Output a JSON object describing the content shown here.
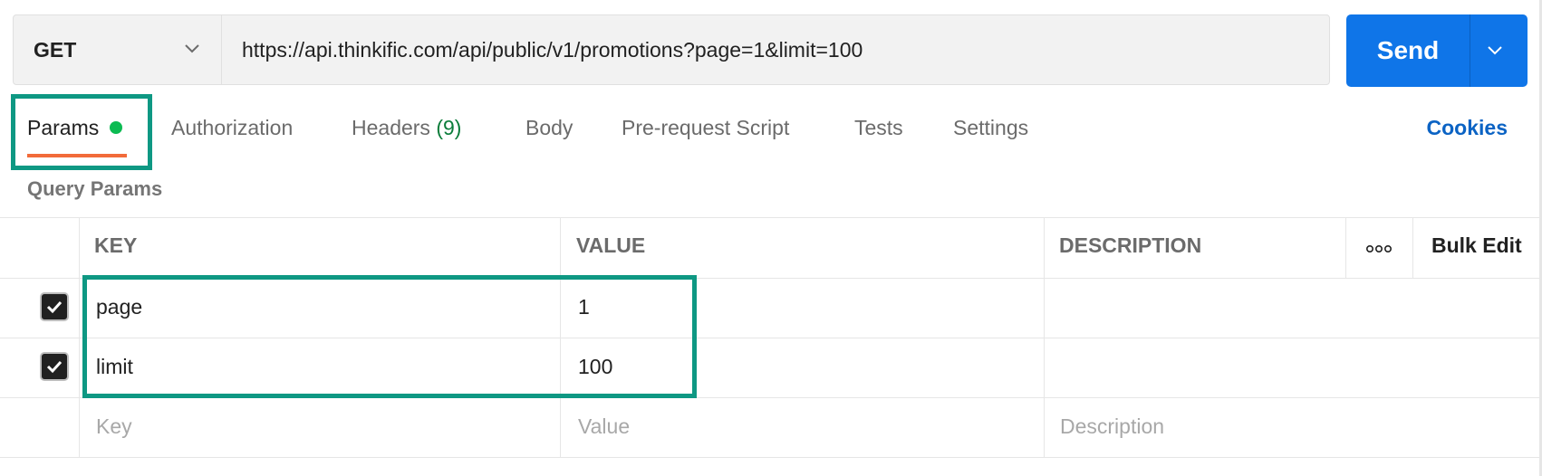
{
  "request": {
    "method": "GET",
    "url": "https://api.thinkific.com/api/public/v1/promotions?page=1&limit=100",
    "send_label": "Send"
  },
  "tabs": [
    {
      "label": "Params"
    },
    {
      "label": "Authorization"
    },
    {
      "label": "Headers",
      "count": "(9)"
    },
    {
      "label": "Body"
    },
    {
      "label": "Pre-request Script"
    },
    {
      "label": "Tests"
    },
    {
      "label": "Settings"
    }
  ],
  "cookies_label": "Cookies",
  "query_params": {
    "title": "Query Params",
    "columns": [
      "KEY",
      "VALUE",
      "DESCRIPTION"
    ],
    "bulk_edit_label": "Bulk Edit",
    "rows": [
      {
        "key": "page",
        "value": "1",
        "description": "",
        "checked": true
      },
      {
        "key": "limit",
        "value": "100",
        "description": "",
        "checked": true
      }
    ],
    "placeholders": {
      "key": "Key",
      "value": "Value",
      "description": "Description"
    }
  },
  "colors": {
    "send": "#0f75e8",
    "active_underline": "#f26b3a",
    "active_dot": "#0cbb52",
    "highlight": "#0e9883",
    "link": "#0b63c4"
  },
  "icons": [
    "chevron-down-icon",
    "more-options-icon",
    "check-icon"
  ]
}
